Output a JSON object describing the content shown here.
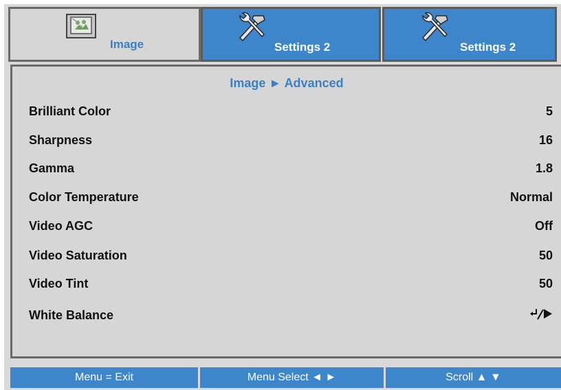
{
  "tabs": [
    {
      "label": "Image",
      "icon": "image-icon",
      "active": true
    },
    {
      "label": "Settings 2",
      "icon": "wrench-hammer-icon",
      "active": false
    },
    {
      "label": "Settings 2",
      "icon": "wrench-hammer-icon",
      "active": false
    }
  ],
  "panel": {
    "title": "Image ► Advanced",
    "rows": [
      {
        "label": "Brilliant Color",
        "value": "5"
      },
      {
        "label": "Sharpness",
        "value": "16"
      },
      {
        "label": "Gamma",
        "value": "1.8"
      },
      {
        "label": "Color Temperature",
        "value": "Normal"
      },
      {
        "label": "Video AGC",
        "value": "Off"
      },
      {
        "label": "Video Saturation",
        "value": "50"
      },
      {
        "label": "Video Tint",
        "value": "50"
      },
      {
        "label": "White Balance",
        "value_icon": "enter-arrow-icon"
      }
    ]
  },
  "bottom_bar": {
    "menu_exit": "Menu = Exit",
    "menu_select": "Menu Select ◄ ►",
    "scroll": "Scroll ▲ ▼"
  },
  "colors": {
    "accent_blue": "#3d86cc",
    "title_blue": "#3b7fc4",
    "panel_gray": "#d6d6d6",
    "border_gray": "#6a6a6a"
  }
}
